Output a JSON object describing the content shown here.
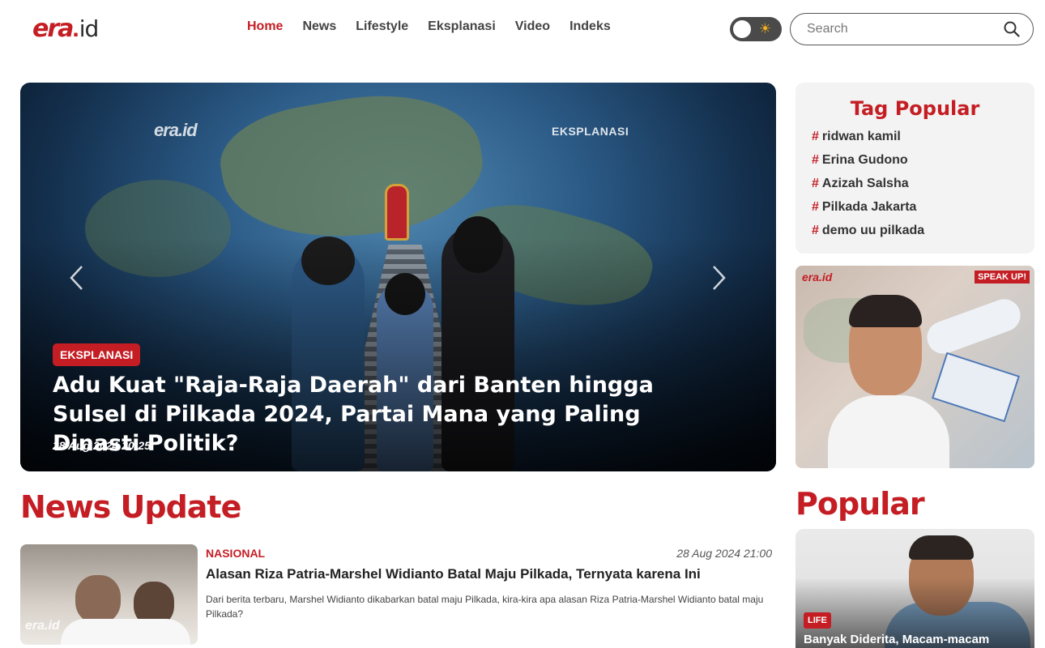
{
  "header": {
    "logo_text": "era.id",
    "nav": [
      "Home",
      "News",
      "Lifestyle",
      "Eksplanasi",
      "Video",
      "Indeks"
    ],
    "active_nav": "Home",
    "search_placeholder": "Search"
  },
  "hero": {
    "category": "EKSPLANASI",
    "title": "Adu Kuat \"Raja-Raja Daerah\" dari Banten hingga Sulsel di Pilkada 2024, Partai Mana yang Paling Dinasti Politik?",
    "date": "28 Aug 2024 20:25",
    "watermark_logo": "era.id",
    "watermark_label": "EKSPLANASI"
  },
  "tag_popular": {
    "heading": "Tag Popular",
    "tags": [
      "ridwan kamil",
      "Erina Gudono",
      "Azizah Salsha",
      "Pilkada Jakarta",
      "demo uu pilkada"
    ]
  },
  "ad": {
    "logo": "era.id",
    "badge": "SPEAK UP!"
  },
  "news_update": {
    "heading": "News Update",
    "items": [
      {
        "category": "NASIONAL",
        "date": "28 Aug 2024 21:00",
        "title": "Alasan Riza Patria-Marshel Widianto Batal Maju Pilkada, Ternyata karena Ini",
        "summary": "Dari berita terbaru, Marshel Widianto dikabarkan batal maju Pilkada, kira-kira apa alasan Riza Patria-Marshel Widianto batal maju Pilkada?",
        "thumb_watermark": "era.id"
      }
    ]
  },
  "popular": {
    "heading": "Popular",
    "items": [
      {
        "category": "LIFE",
        "title": "Banyak Diderita, Macam-macam"
      }
    ]
  },
  "colors": {
    "accent": "#c41e24",
    "toggle_bg": "#4a4a4a",
    "sun": "#f2b01e"
  }
}
